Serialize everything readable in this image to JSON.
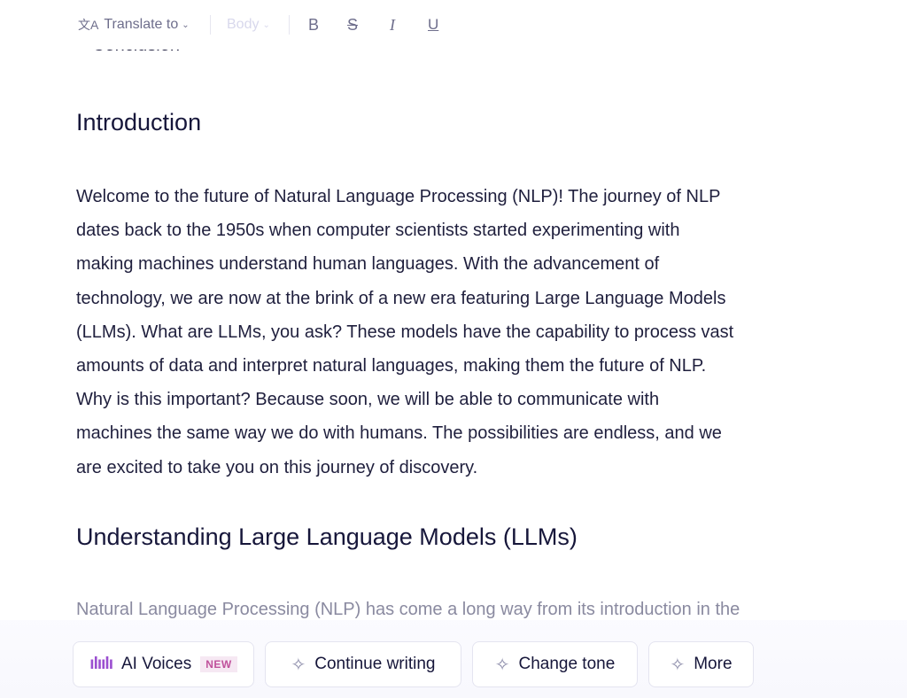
{
  "toolbar": {
    "translate_label": "Translate to",
    "style_label": "Body",
    "bold_label": "B",
    "strike_label": "S",
    "italic_label": "I",
    "underline_label": "U"
  },
  "document": {
    "clipped_item": "Conclusion",
    "heading1": "Introduction",
    "paragraph_lines": [
      "Welcome to the future of Natural Language Processing (NLP)! The journey of NLP",
      "dates back to the 1950s when computer scientists started experimenting with",
      "making machines understand human languages. With the advancement of",
      "technology, we are now at the brink of a new era featuring Large Language Models",
      "(LLMs). What are LLMs, you ask? These models have the capability to process vast",
      "amounts of data and interpret natural languages, making them the future of NLP.",
      "Why is this important? Because soon, we will be able to communicate with",
      "machines the same way we do with humans. The possibilities are endless, and we",
      "are excited to take you on this journey of discovery."
    ],
    "heading2": "Understanding Large Language Models (LLMs)",
    "faded_line": "Natural Language Processing (NLP) has come a long way from its introduction in the"
  },
  "actions": {
    "ai_voices": "AI Voices",
    "new_badge": "NEW",
    "continue_writing": "Continue writing",
    "change_tone": "Change tone",
    "more": "More"
  },
  "colors": {
    "accent": "#9b4fd0",
    "badge": "#c0529c"
  }
}
